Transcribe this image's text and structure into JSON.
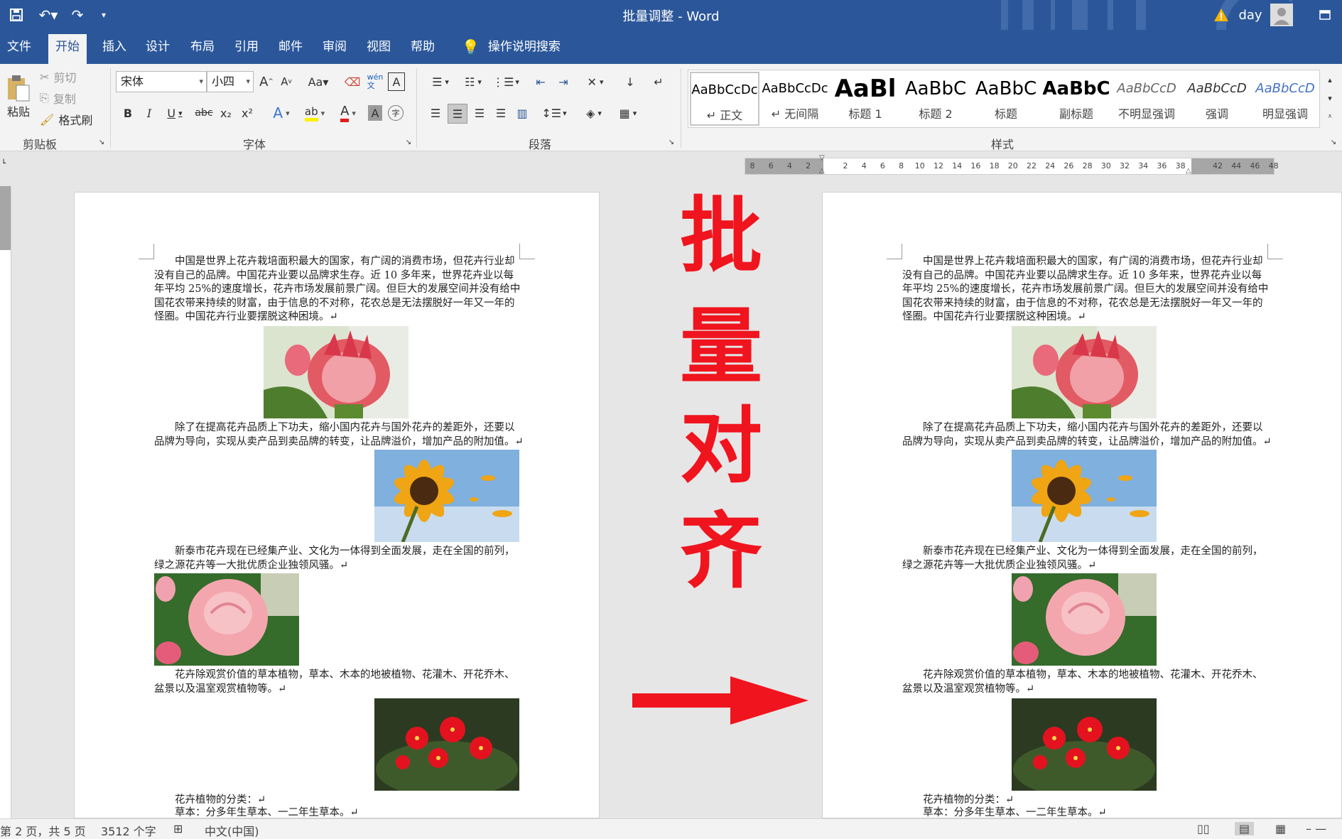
{
  "window": {
    "title": "批量调整  -  Word",
    "user": "day",
    "warning_icon": "warning-icon"
  },
  "menu": [
    "文件",
    "开始",
    "插入",
    "设计",
    "布局",
    "引用",
    "邮件",
    "审阅",
    "视图",
    "帮助"
  ],
  "menu_active": "开始",
  "tell_me": "操作说明搜索",
  "clipboard": {
    "paste": "粘贴",
    "cut": "剪切",
    "copy": "复制",
    "format_painter": "格式刷",
    "label": "剪贴板"
  },
  "font": {
    "name": "宋体",
    "size": "小四",
    "label": "字体",
    "grow": "A",
    "shrink": "A",
    "case": "Aa",
    "phonetic": "wén\n文",
    "border_char": "A",
    "bold": "B",
    "italic": "I",
    "underline": "U",
    "strike": "abc",
    "sub": "x₂",
    "sup": "x²",
    "color_char": "A",
    "shade_char": "A",
    "circle_char": "字"
  },
  "paragraph": {
    "label": "段落"
  },
  "styles": {
    "label": "样式",
    "items": [
      {
        "preview": "AaBbCcDc",
        "name": "↵ 正文"
      },
      {
        "preview": "AaBbCcDc",
        "name": "↵ 无间隔"
      },
      {
        "preview": "AaBl",
        "name": "标题 1"
      },
      {
        "preview": "AaBbC",
        "name": "标题 2"
      },
      {
        "preview": "AaBbC",
        "name": "标题"
      },
      {
        "preview": "AaBbC",
        "name": "副标题"
      },
      {
        "preview": "AaBbCcD",
        "name": "不明显强调"
      },
      {
        "preview": "AaBbCcD",
        "name": "强调"
      },
      {
        "preview": "AaBbCcD",
        "name": "明显强调"
      }
    ]
  },
  "ruler_h": [
    "8",
    "6",
    "4",
    "2",
    "",
    "2",
    "4",
    "6",
    "8",
    "10",
    "12",
    "14",
    "16",
    "18",
    "20",
    "22",
    "24",
    "26",
    "28",
    "30",
    "32",
    "34",
    "36",
    "38",
    "",
    "42",
    "44",
    "46",
    "48"
  ],
  "doc": {
    "p1": "中国是世界上花卉栽培面积最大的国家，有广阔的消费市场，但花卉行业却没有自己的品牌。中国花卉业要以品牌求生存。近 10 多年来，世界花卉业以每年平均 25%的速度增长，花卉市场发展前景广阔。但巨大的发展空间并没有给中国花农带来持续的财富，由于信息的不对称，花农总是无法摆脱好一年又一年的怪圈。中国花卉行业要摆脱这种困境。↵",
    "p2": "除了在提高花卉品质上下功夫，缩小国内花卉与国外花卉的差距外，还要以品牌为导向，实现从卖产品到卖品牌的转变，让品牌溢价，增加产品的附加值。↵",
    "p3": "新泰市花卉现在已经集产业、文化为一体得到全面发展，走在全国的前列，绿之源花卉等一大批优质企业独领风骚。↵",
    "p4": "花卉除观赏价值的草本植物，草本、木本的地被植物、花灌木、开花乔木、盆景以及温室观赏植物等。↵",
    "p5": "花卉植物的分类：↵",
    "p6": "草本：分多年生草本、一二年生草本。↵"
  },
  "overlay": {
    "chars": [
      "批",
      "量",
      "对",
      "齐"
    ]
  },
  "status": {
    "page": "第 2 页，共 5 页",
    "words": "3512 个字",
    "lang": "中文(中国)"
  }
}
